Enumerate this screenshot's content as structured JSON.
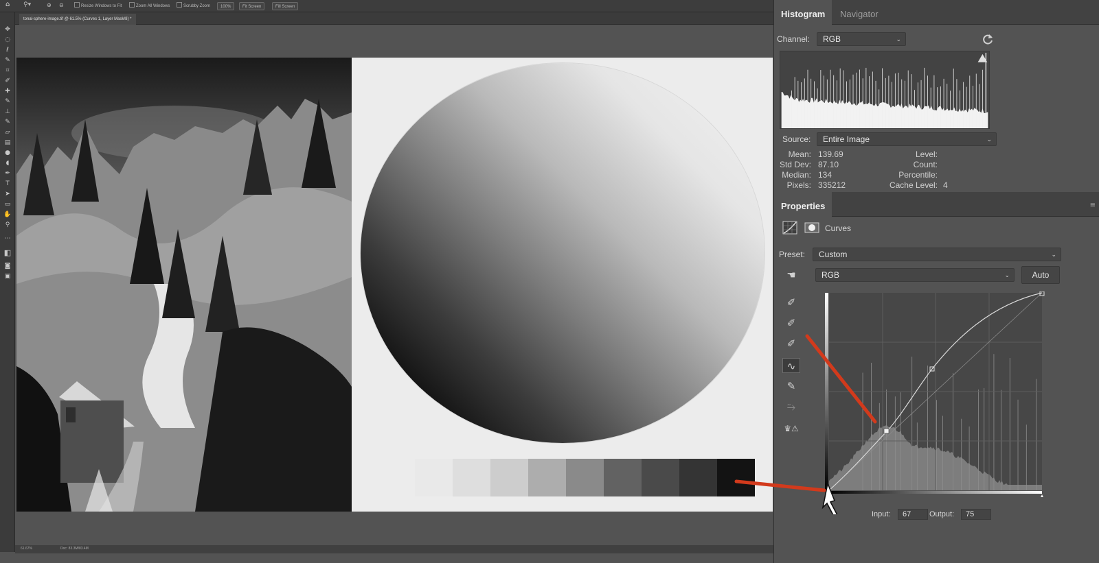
{
  "options_bar": {
    "resize_windows": "Resize Windows to Fit",
    "zoom_all": "Zoom All Windows",
    "scrubby_zoom": "Scrubby Zoom",
    "zoom_100": "100%",
    "fit_screen": "Fit Screen",
    "fill_screen": "Fill Screen"
  },
  "document_tab": "tonal-sphere-image.tif @ 61.5% (Curves 1, Layer Mask/8) *",
  "status_bar": {
    "zoom": "61.67%",
    "doc_size": "Doc: 83.3M/83.4M"
  },
  "swatches": [
    "#e9e9e9",
    "#dedede",
    "#cdcdcd",
    "#adadad",
    "#8a8a8a",
    "#626262",
    "#4a4a4a",
    "#343434",
    "#131313"
  ],
  "histogram_panel": {
    "tabs": [
      "Histogram",
      "Navigator"
    ],
    "channel_label": "Channel:",
    "channel_value": "RGB",
    "source_label": "Source:",
    "source_value": "Entire Image",
    "stats_left": [
      {
        "label": "Mean:",
        "value": "139.69"
      },
      {
        "label": "Std Dev:",
        "value": "87.10"
      },
      {
        "label": "Median:",
        "value": "134"
      },
      {
        "label": "Pixels:",
        "value": "335212"
      }
    ],
    "stats_right": [
      {
        "label": "Level:",
        "value": ""
      },
      {
        "label": "Count:",
        "value": ""
      },
      {
        "label": "Percentile:",
        "value": ""
      },
      {
        "label": "Cache Level:",
        "value": "4"
      }
    ]
  },
  "properties_panel": {
    "title": "Properties",
    "adjustment": "Curves",
    "preset_label": "Preset:",
    "preset_value": "Custom",
    "channel_value": "RGB",
    "auto_label": "Auto",
    "input_label": "Input:",
    "input_value": "67",
    "output_label": "Output:",
    "output_value": "75"
  },
  "icons": [
    "home-icon",
    "zoom-tool-icon",
    "warning-icon",
    "refresh-icon",
    "curves-icon",
    "mask-icon",
    "eyedropper-icon",
    "pencil-icon",
    "cursor-icon"
  ]
}
